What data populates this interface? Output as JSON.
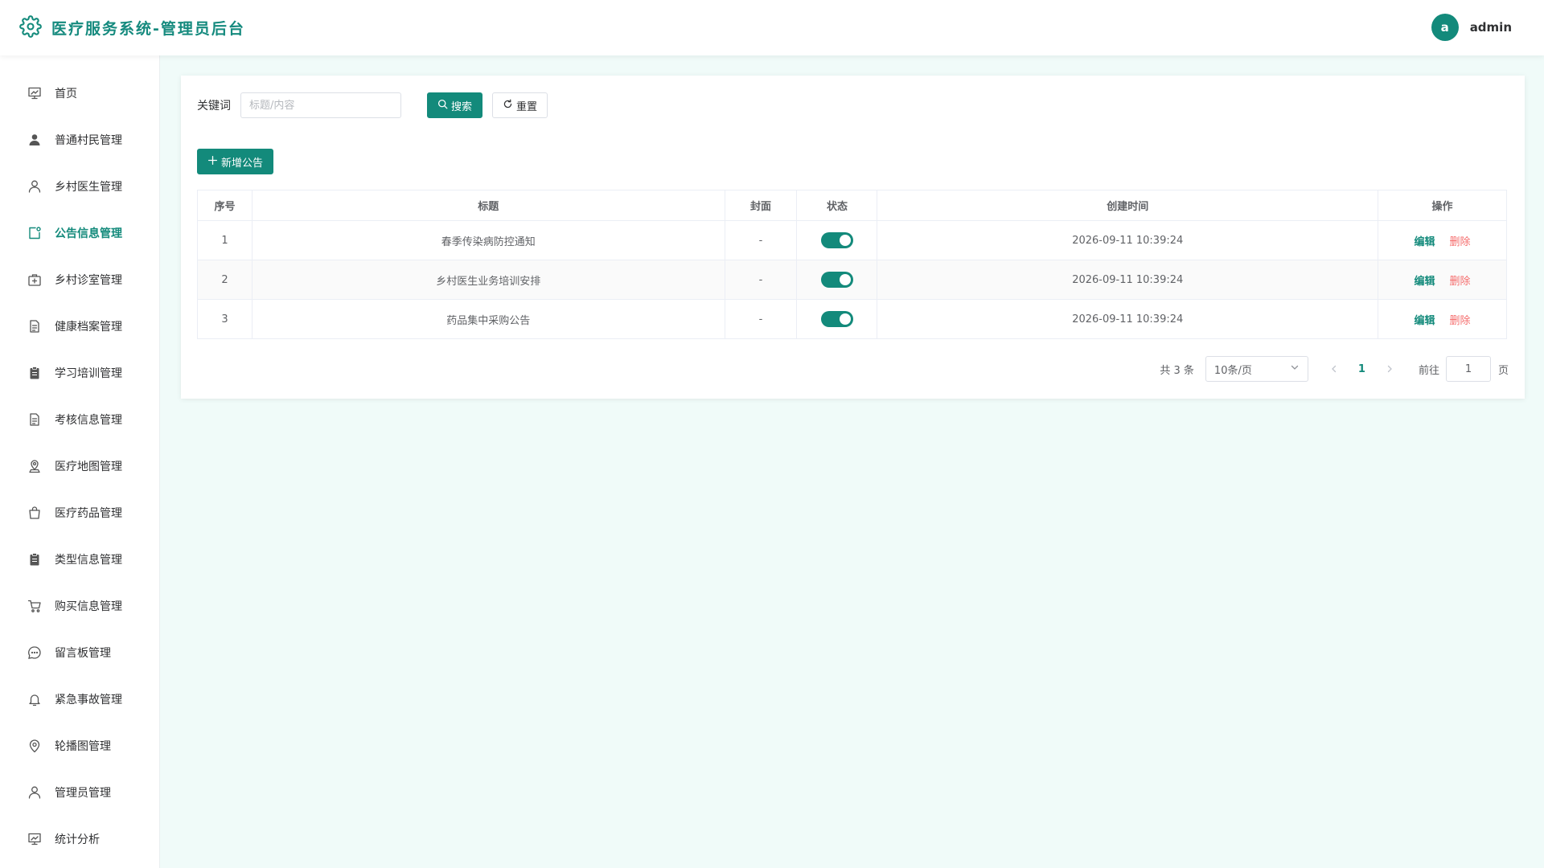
{
  "header": {
    "title": "医疗服务系统-管理员后台",
    "user": {
      "avatar_letter": "a",
      "name": "admin"
    }
  },
  "colors": {
    "primary": "#138a7b",
    "danger": "#f56c6c",
    "background": "#f0fbf9"
  },
  "sidebar": {
    "items": [
      {
        "label": "首页",
        "icon": "dashboard-icon",
        "active": false
      },
      {
        "label": "普通村民管理",
        "icon": "user-filled-icon",
        "active": false
      },
      {
        "label": "乡村医生管理",
        "icon": "user-icon",
        "active": false
      },
      {
        "label": "公告信息管理",
        "icon": "notice-icon",
        "active": true
      },
      {
        "label": "乡村诊室管理",
        "icon": "first-aid-kit-icon",
        "active": false
      },
      {
        "label": "健康档案管理",
        "icon": "document-icon",
        "active": false
      },
      {
        "label": "学习培训管理",
        "icon": "clipboard-icon",
        "active": false
      },
      {
        "label": "考核信息管理",
        "icon": "document-icon",
        "active": false
      },
      {
        "label": "医疗地图管理",
        "icon": "map-location-icon",
        "active": false
      },
      {
        "label": "医疗药品管理",
        "icon": "shopping-bag-icon",
        "active": false
      },
      {
        "label": "类型信息管理",
        "icon": "clipboard-icon",
        "active": false
      },
      {
        "label": "购买信息管理",
        "icon": "shopping-cart-icon",
        "active": false
      },
      {
        "label": "留言板管理",
        "icon": "chat-icon",
        "active": false
      },
      {
        "label": "紧急事故管理",
        "icon": "bell-icon",
        "active": false
      },
      {
        "label": "轮播图管理",
        "icon": "location-icon",
        "active": false
      },
      {
        "label": "管理员管理",
        "icon": "user-icon",
        "active": false
      },
      {
        "label": "统计分析",
        "icon": "dashboard-icon",
        "active": false
      }
    ]
  },
  "search": {
    "label": "关键词",
    "placeholder": "标题/内容",
    "search_button": "搜索",
    "reset_button": "重置"
  },
  "add_button": "新增公告",
  "table": {
    "columns": [
      "序号",
      "标题",
      "封面",
      "状态",
      "创建时间",
      "操作"
    ],
    "rows": [
      {
        "index": "1",
        "title": "春季传染病防控通知",
        "cover": "-",
        "status_on": true,
        "created": "2026-09-11 10:39:24",
        "edit": "编辑",
        "delete": "删除"
      },
      {
        "index": "2",
        "title": "乡村医生业务培训安排",
        "cover": "-",
        "status_on": true,
        "created": "2026-09-11 10:39:24",
        "edit": "编辑",
        "delete": "删除"
      },
      {
        "index": "3",
        "title": "药品集中采购公告",
        "cover": "-",
        "status_on": true,
        "created": "2026-09-11 10:39:24",
        "edit": "编辑",
        "delete": "删除"
      }
    ]
  },
  "pagination": {
    "total_text": "共 3 条",
    "page_size": "10条/页",
    "current_page": "1",
    "goto_label": "前往",
    "goto_value": "1",
    "goto_suffix": "页"
  }
}
